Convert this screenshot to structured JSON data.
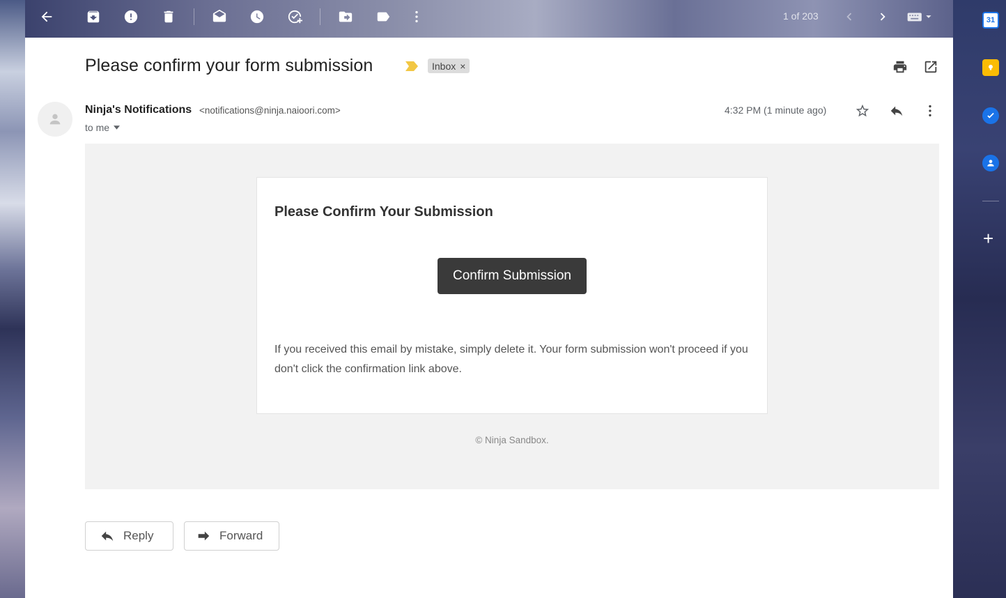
{
  "toolbar": {
    "icons": [
      "back-arrow-icon",
      "archive-icon",
      "report-spam-icon",
      "delete-icon",
      "mark-unread-icon",
      "snooze-icon",
      "add-to-tasks-icon",
      "move-to-icon",
      "labels-icon",
      "more-vertical-icon"
    ],
    "pager": "1 of 203",
    "pager_icons": [
      "chevron-left-icon",
      "chevron-right-icon",
      "keyboard-icon"
    ]
  },
  "subject": "Please confirm your form submission",
  "label": "Inbox",
  "label_remove": "×",
  "header_icons": [
    "print-icon",
    "open-in-new-window-icon"
  ],
  "message": {
    "sender_name": "Ninja's Notifications",
    "sender_email": "<notifications@ninja.naioori.com>",
    "recipient": "to me",
    "timestamp": "4:32 PM (1 minute ago)"
  },
  "email_content": {
    "title": "Please Confirm Your Submission",
    "button_label": "Confirm Submission",
    "body_text": "If you received this email by mistake, simply delete it. Your form submission won't proceed if you don't click the confirmation link above.",
    "footer": "© Ninja Sandbox."
  },
  "actions": {
    "reply": "Reply",
    "forward": "Forward"
  },
  "side_rail": {
    "icons": [
      "google-calendar-icon",
      "google-keep-icon",
      "google-tasks-icon",
      "google-contacts-icon",
      "add-addons-icon"
    ],
    "calendar_day": "31",
    "colors": {
      "calendar": "#1a73e8",
      "keep": "#fbbc04",
      "tasks": "#1a73e8",
      "contacts": "#1a73e8"
    }
  },
  "colors": {
    "important_marker": "#f2c744",
    "button_dark": "#3a3a3a"
  }
}
